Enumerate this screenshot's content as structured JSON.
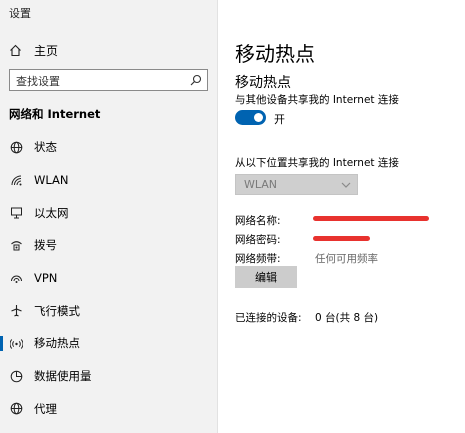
{
  "window": {
    "title": "设置"
  },
  "sidebar": {
    "home_label": "主页",
    "search": {
      "placeholder": "查找设置",
      "icon": "search-icon"
    },
    "section_title": "网络和 Internet",
    "items": [
      {
        "label": "状态",
        "icon": "globe-icon",
        "active": false
      },
      {
        "label": "WLAN",
        "icon": "wifi-icon",
        "active": false
      },
      {
        "label": "以太网",
        "icon": "ethernet-icon",
        "active": false
      },
      {
        "label": "拨号",
        "icon": "dialup-icon",
        "active": false
      },
      {
        "label": "VPN",
        "icon": "vpn-icon",
        "active": false
      },
      {
        "label": "飞行模式",
        "icon": "airplane-icon",
        "active": false
      },
      {
        "label": "移动热点",
        "icon": "hotspot-icon",
        "active": true
      },
      {
        "label": "数据使用量",
        "icon": "data-usage-icon",
        "active": false
      },
      {
        "label": "代理",
        "icon": "proxy-globe-icon",
        "active": false
      }
    ]
  },
  "main": {
    "page_title": "移动热点",
    "section_title": "移动热点",
    "share_label": "与其他设备共享我的 Internet 连接",
    "toggle": {
      "state": "开",
      "on": true
    },
    "from_label": "从以下位置共享我的 Internet 连接",
    "from_select": {
      "value": "WLAN"
    },
    "network_name_label": "网络名称:",
    "network_password_label": "网络密码:",
    "network_band_label": "网络频带:",
    "network_band_value": "任何可用频率",
    "edit_button": "编辑",
    "connected_label": "已连接的设备:",
    "connected_value": "0 台(共 8 台)"
  },
  "colors": {
    "accent": "#0063b1",
    "redaction": "#e8322e",
    "sidebar_bg": "#f2f2f2",
    "disabled_select": "#cfcfcf"
  }
}
